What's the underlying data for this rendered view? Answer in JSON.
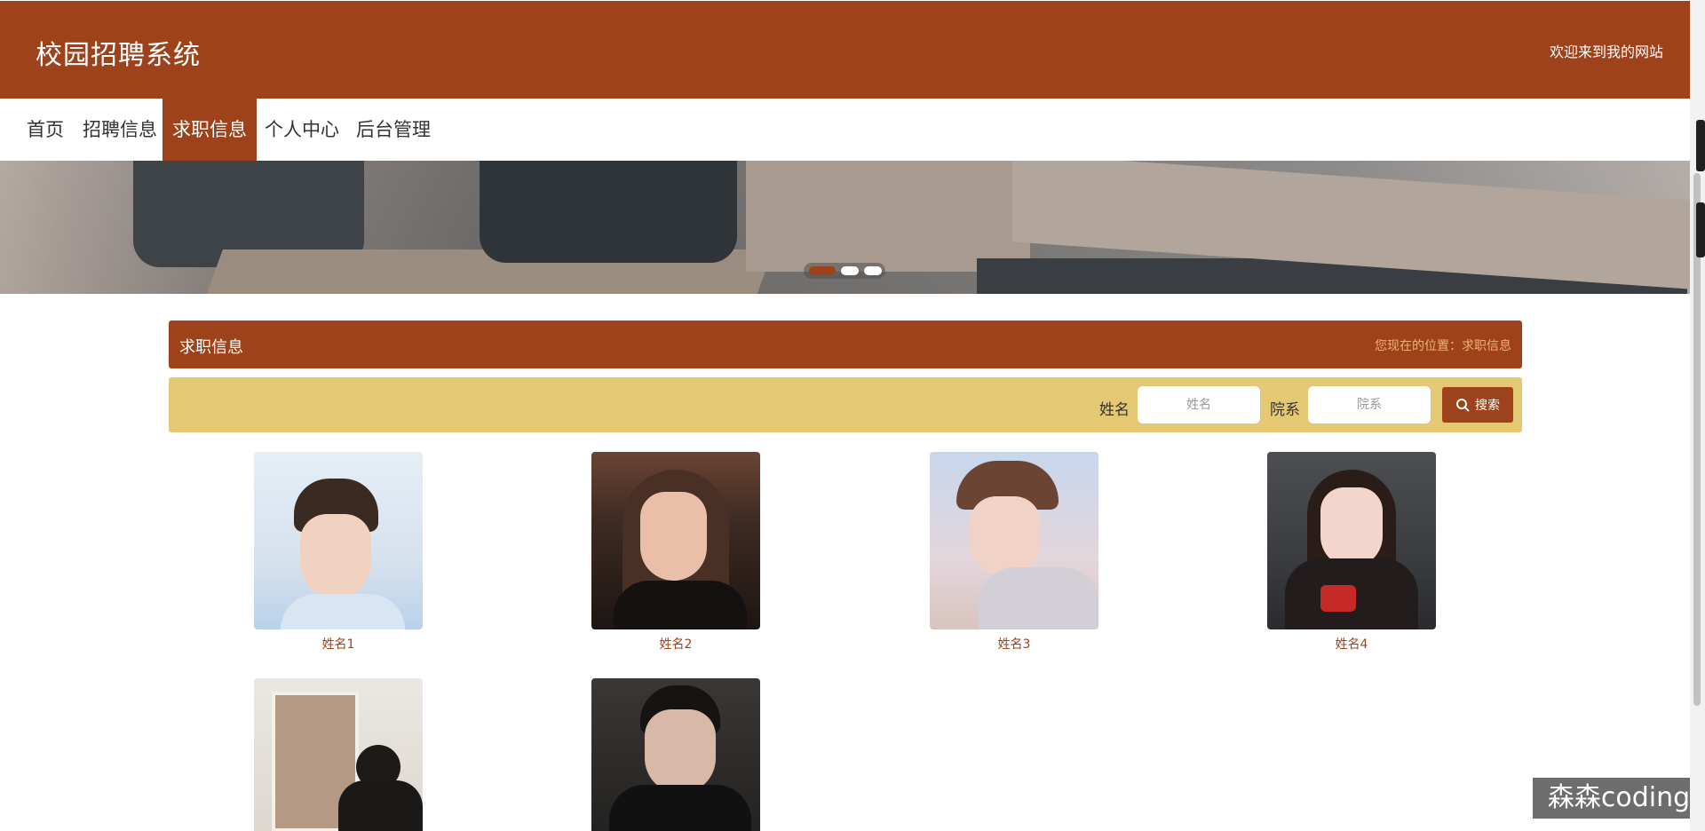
{
  "header": {
    "brand": "校园招聘系统",
    "welcome": "欢迎来到我的网站"
  },
  "nav": {
    "items": [
      {
        "label": "首页",
        "active": false
      },
      {
        "label": "招聘信息",
        "active": false
      },
      {
        "label": "求职信息",
        "active": true
      },
      {
        "label": "个人中心",
        "active": false
      },
      {
        "label": "后台管理",
        "active": false
      }
    ]
  },
  "carousel": {
    "slide_count": 3,
    "active_index": 0
  },
  "panel": {
    "title": "求职信息",
    "breadcrumb": "您现在的位置：求职信息"
  },
  "search": {
    "name_label": "姓名",
    "name_placeholder": "姓名",
    "dept_label": "院系",
    "dept_placeholder": "院系",
    "button_label": "搜索"
  },
  "cards": [
    {
      "name": "姓名1"
    },
    {
      "name": "姓名2"
    },
    {
      "name": "姓名3"
    },
    {
      "name": "姓名4"
    },
    {
      "name": ""
    },
    {
      "name": ""
    }
  ],
  "watermark": "森森coding",
  "colors": {
    "primary": "#9d421a",
    "search_bg": "#e5c874",
    "breadcrumb": "#f0b074"
  }
}
